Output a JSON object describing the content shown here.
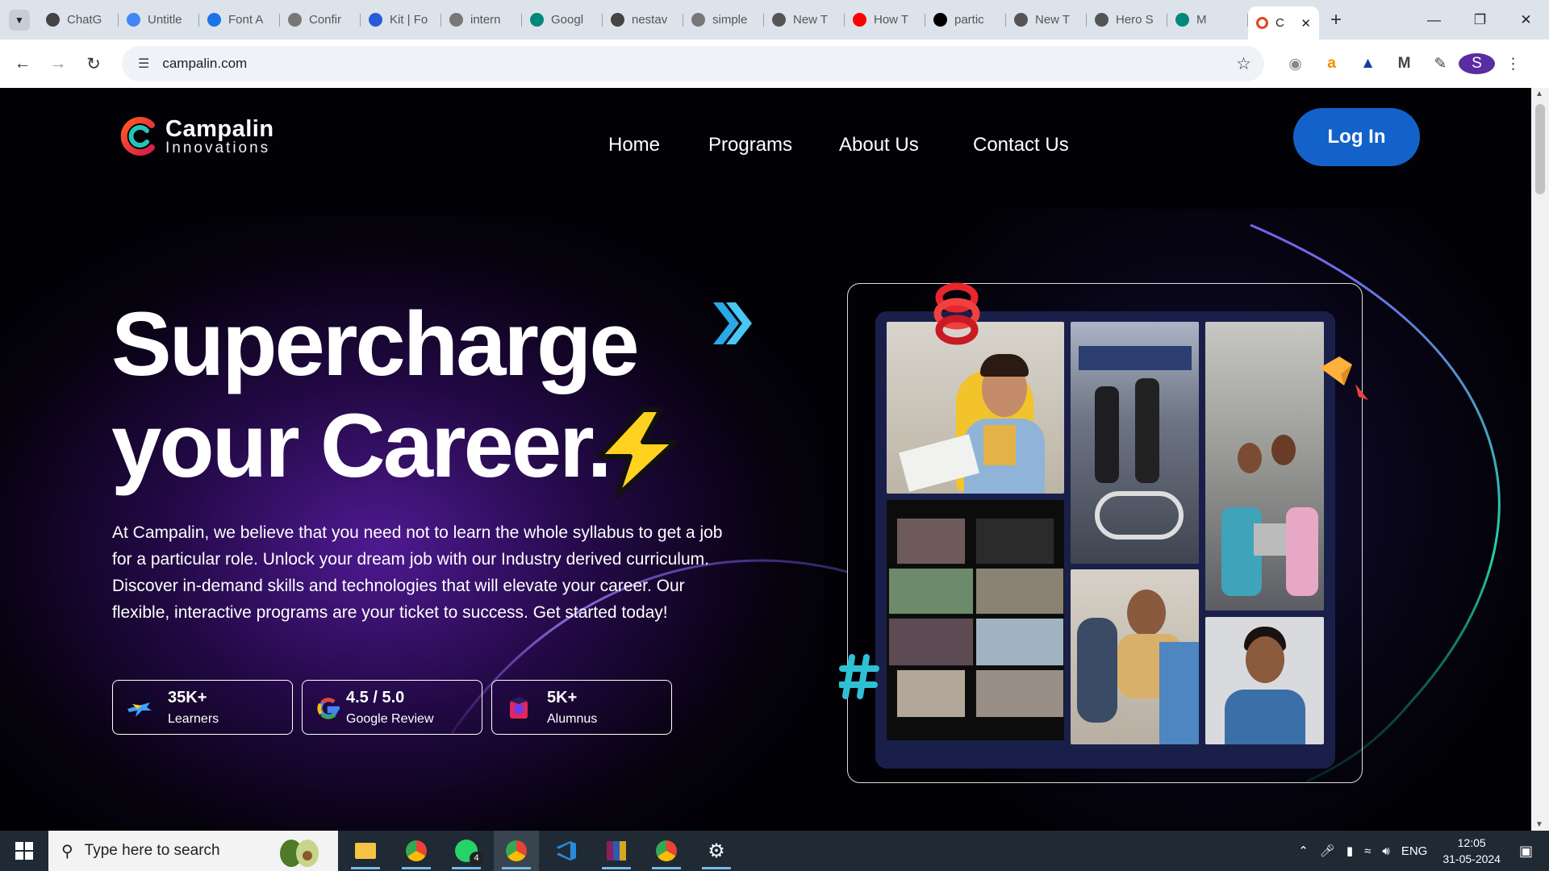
{
  "browser": {
    "tabs": [
      {
        "title": "ChatG",
        "icon": "chatgpt-icon"
      },
      {
        "title": "Untitle",
        "icon": "docs-icon"
      },
      {
        "title": "Font A",
        "icon": "flag-icon"
      },
      {
        "title": "Confir",
        "icon": "gmail-icon"
      },
      {
        "title": "Kit | Fo",
        "icon": "fontawesome-icon"
      },
      {
        "title": "intern",
        "icon": "google-icon"
      },
      {
        "title": "Googl",
        "icon": "meet-icon"
      },
      {
        "title": "nestav",
        "icon": "chatgpt-icon"
      },
      {
        "title": "simple",
        "icon": "google-icon"
      },
      {
        "title": "New T",
        "icon": "chrome-icon"
      },
      {
        "title": "How T",
        "icon": "youtube-icon"
      },
      {
        "title": "partic",
        "icon": "notion-icon"
      },
      {
        "title": "New T",
        "icon": "chrome-icon"
      },
      {
        "title": "Hero S",
        "icon": "globe-icon"
      },
      {
        "title": "M",
        "icon": "meet-icon"
      }
    ],
    "active_tab": {
      "title": "C",
      "icon": "campalin-icon"
    },
    "url": "campalin.com",
    "profile_initial": "S"
  },
  "site": {
    "logo": {
      "name": "Campalin",
      "sub": "Innovations"
    },
    "nav": [
      "Home",
      "Programs",
      "About Us",
      "Contact Us"
    ],
    "login": "Log In",
    "headline_1": "Supercharge",
    "headline_2": "your Career.",
    "paragraph_lines": [
      "At Campalin, we believe that you need not to learn the whole syllabus to get a job",
      "for a particular role. Unlock your dream job with our Industry derived curriculum.",
      "Discover in-demand skills and technologies that will elevate your career. Our",
      "flexible, interactive programs are your ticket to success. Get started today!"
    ],
    "stats": [
      {
        "value": "35K+",
        "label": "Learners",
        "icon": "airplane-icon"
      },
      {
        "value": "4.5 / 5.0",
        "label": "Google Review",
        "icon": "google-g-icon"
      },
      {
        "value": "5K+",
        "label": "Alumnus",
        "icon": "graduate-icon"
      }
    ],
    "colors": {
      "accent": "#1262c9",
      "bg": "#020105",
      "glow": "#5c1eaa"
    }
  },
  "taskbar": {
    "search_placeholder": "Type here to search",
    "whatsapp_badge": "4",
    "language": "ENG",
    "time": "12:05",
    "date": "31-05-2024"
  }
}
